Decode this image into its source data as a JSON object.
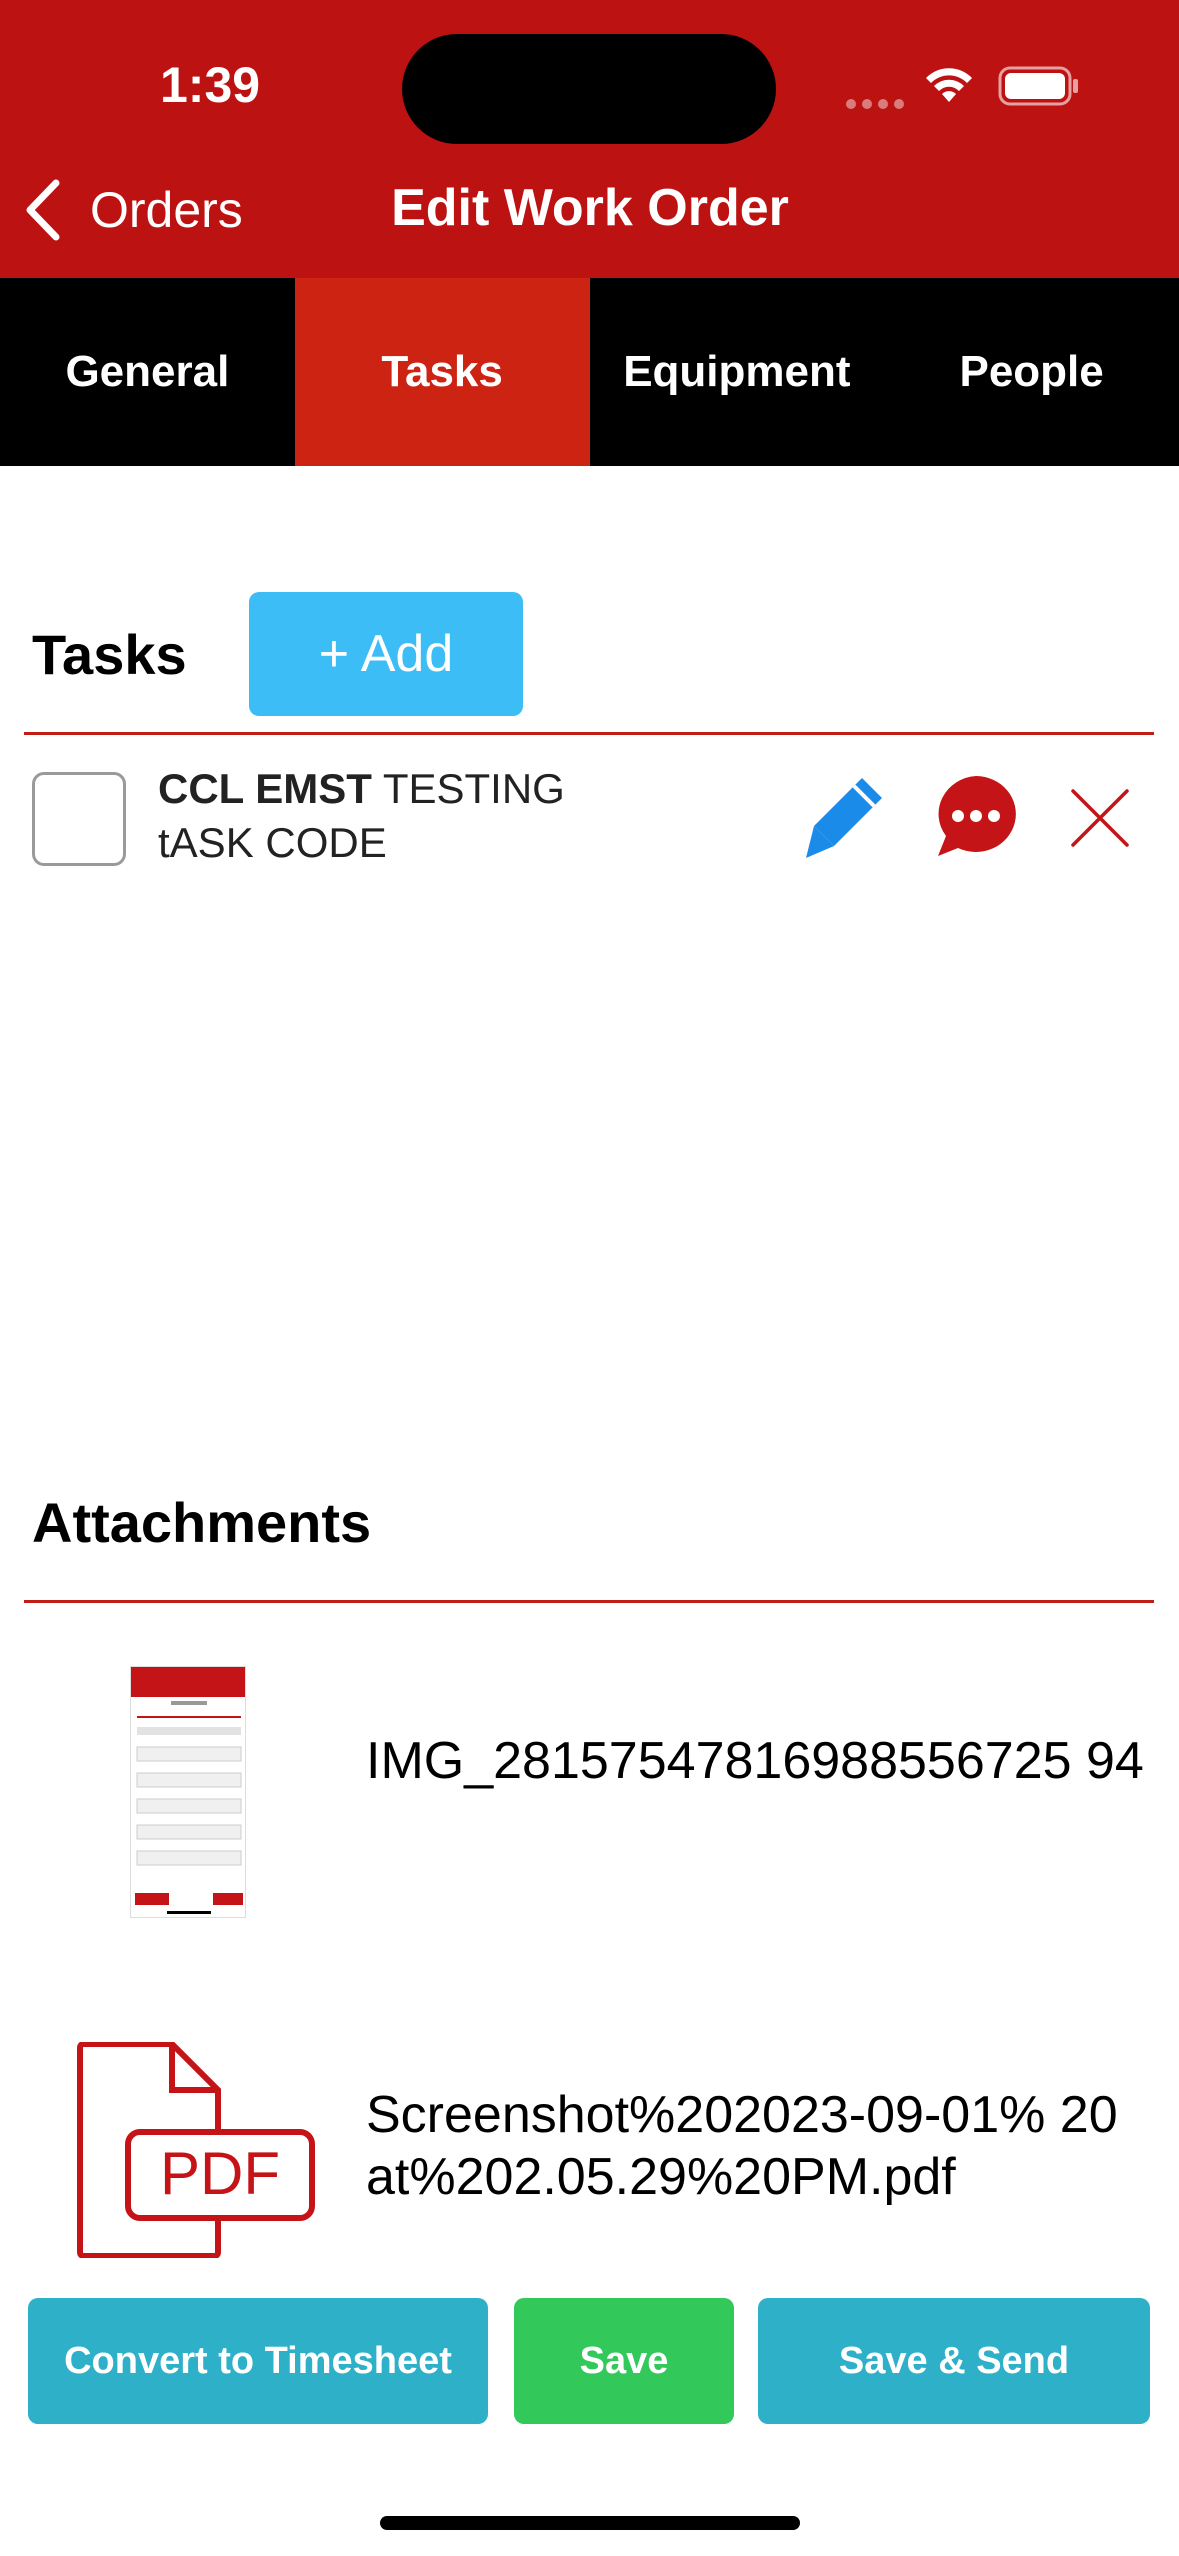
{
  "status_bar": {
    "time": "1:39"
  },
  "nav": {
    "back_label": "Orders",
    "title": "Edit Work Order"
  },
  "tabs": [
    {
      "label": "General"
    },
    {
      "label": "Tasks"
    },
    {
      "label": "Equipment"
    },
    {
      "label": "People"
    }
  ],
  "tasks": {
    "title": "Tasks",
    "add_label": "+ Add",
    "items": [
      {
        "code_bold": "CCL EMST",
        "name_rest": "TESTING",
        "line2": "tASK CODE",
        "checked": false
      }
    ]
  },
  "attachments": {
    "title": "Attachments",
    "items": [
      {
        "name": "IMG_28157547816988556725 94",
        "type": "image"
      },
      {
        "name": "Screenshot%202023-09-01% 20at%202.05.29%20PM.pdf",
        "type": "pdf",
        "icon_label": "PDF"
      }
    ]
  },
  "footer": {
    "convert_label": "Convert to Timesheet",
    "save_label": "Save",
    "save_send_label": "Save & Send"
  },
  "colors": {
    "header_red": "#bd1212",
    "active_tab": "#cc2312",
    "add_blue": "#3cbdf5",
    "save_green": "#33c85a",
    "teal": "#2eb0c9"
  }
}
